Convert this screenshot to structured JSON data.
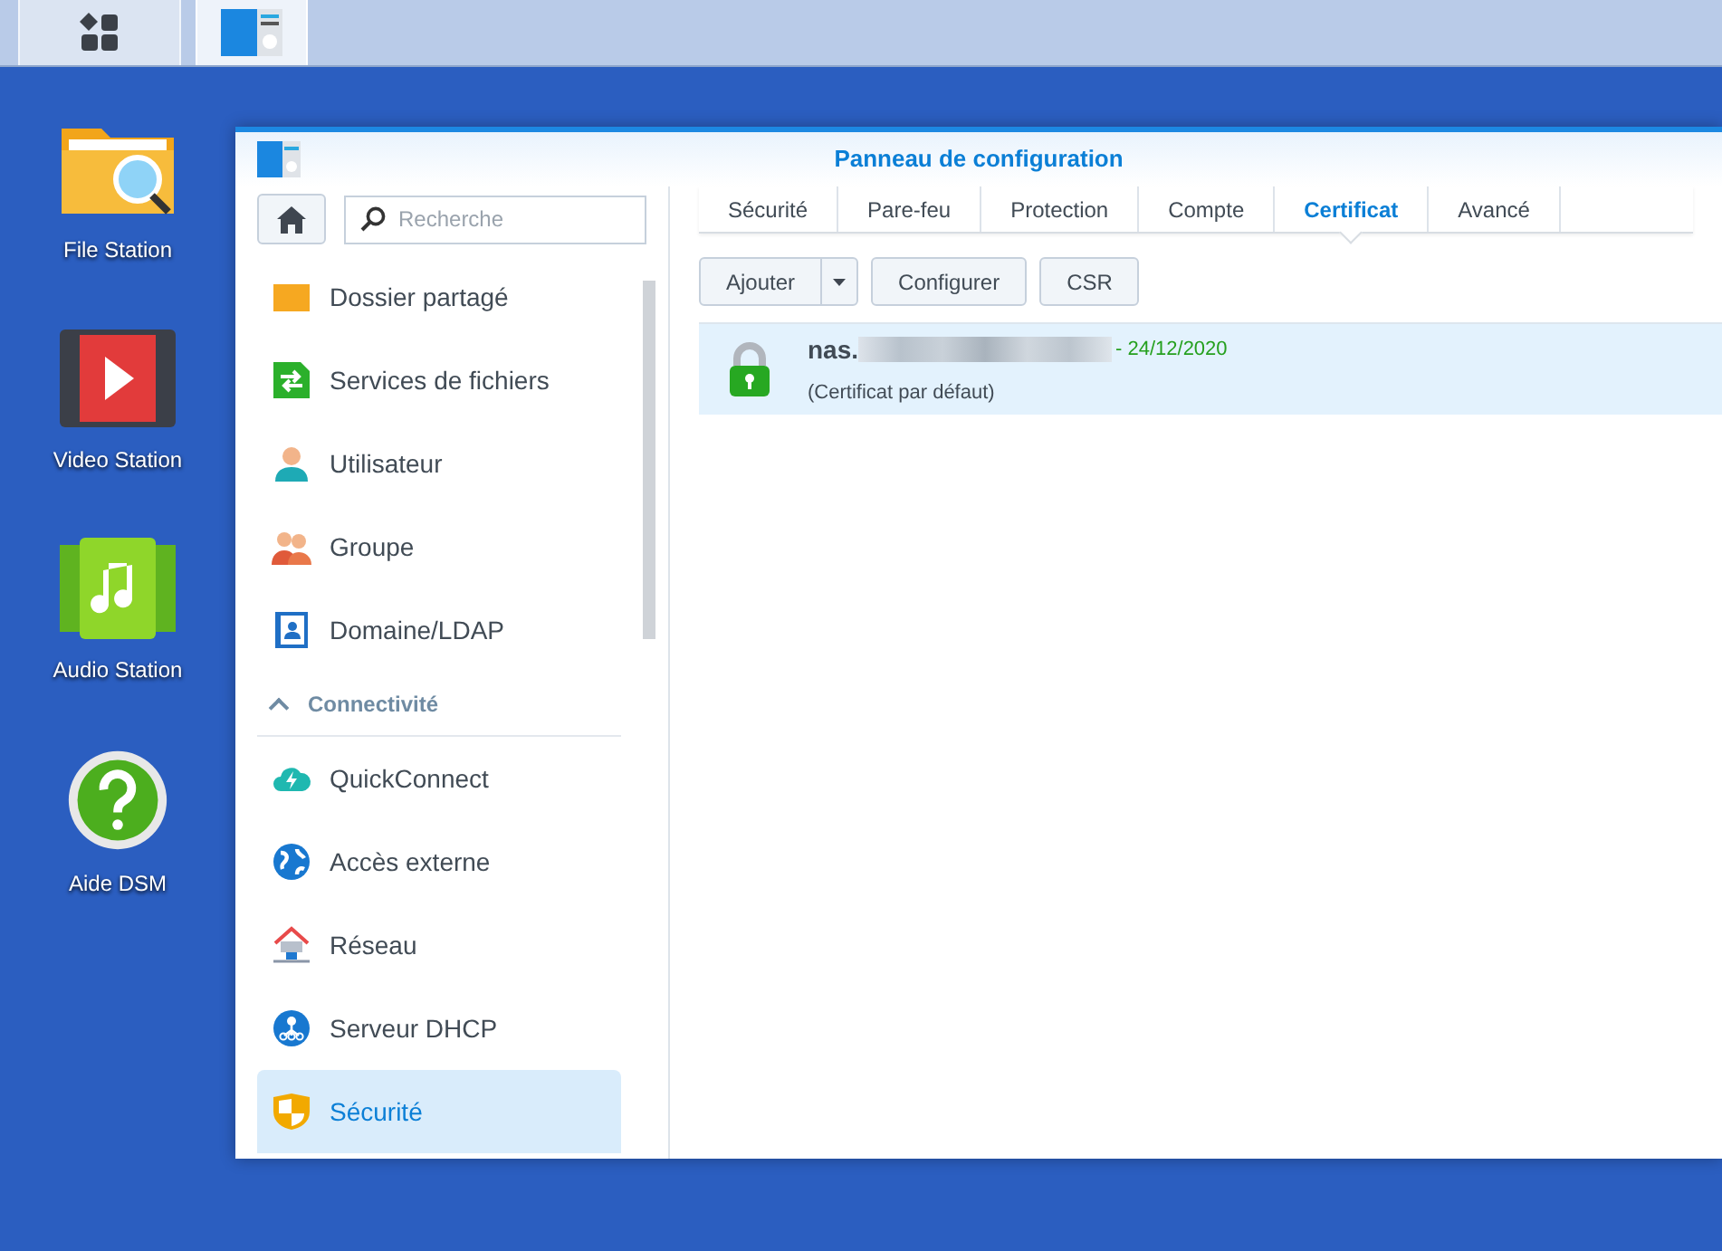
{
  "taskbar": {
    "items": [
      {
        "kind": "apps",
        "selected": false
      },
      {
        "kind": "control-panel",
        "selected": true
      }
    ]
  },
  "desktop_icons": [
    {
      "kind": "file",
      "label": "File Station"
    },
    {
      "kind": "video",
      "label": "Video Station"
    },
    {
      "kind": "audio",
      "label": "Audio Station"
    },
    {
      "kind": "help",
      "label": "Aide DSM"
    }
  ],
  "window": {
    "title": "Panneau de configuration"
  },
  "sidebar": {
    "search": {
      "placeholder": "Recherche"
    },
    "items": [
      {
        "kind": "folder",
        "label": "Dossier partagé",
        "selected": false
      },
      {
        "kind": "files",
        "label": "Services de fichiers",
        "selected": false
      },
      {
        "kind": "user",
        "label": "Utilisateur",
        "selected": false
      },
      {
        "kind": "group",
        "label": "Groupe",
        "selected": false
      },
      {
        "kind": "ldap",
        "label": "Domaine/LDAP",
        "selected": false
      },
      {
        "kind": "header",
        "label": "Connectivité",
        "expanded": true
      },
      {
        "kind": "quickconnect",
        "label": "QuickConnect",
        "selected": false
      },
      {
        "kind": "globe",
        "label": "Accès externe",
        "selected": false
      },
      {
        "kind": "network",
        "label": "Réseau",
        "selected": false
      },
      {
        "kind": "dhcp",
        "label": "Serveur DHCP",
        "selected": false
      },
      {
        "kind": "shield",
        "label": "Sécurité",
        "selected": true
      }
    ]
  },
  "tabs": [
    {
      "label": "Sécurité",
      "selected": false
    },
    {
      "label": "Pare-feu",
      "selected": false
    },
    {
      "label": "Protection",
      "selected": false
    },
    {
      "label": "Compte",
      "selected": false
    },
    {
      "label": "Certificat",
      "selected": true
    },
    {
      "label": "Avancé",
      "selected": false
    }
  ],
  "toolbar": {
    "buttons": [
      {
        "label": "Ajouter",
        "kind": "split"
      },
      {
        "label": "Configurer",
        "kind": "plain"
      },
      {
        "label": "CSR",
        "kind": "plain"
      }
    ]
  },
  "certificates": [
    {
      "name": "nas.",
      "date": "- 24/12/2020",
      "note": "(Certificat par défaut)",
      "selected": true
    }
  ]
}
